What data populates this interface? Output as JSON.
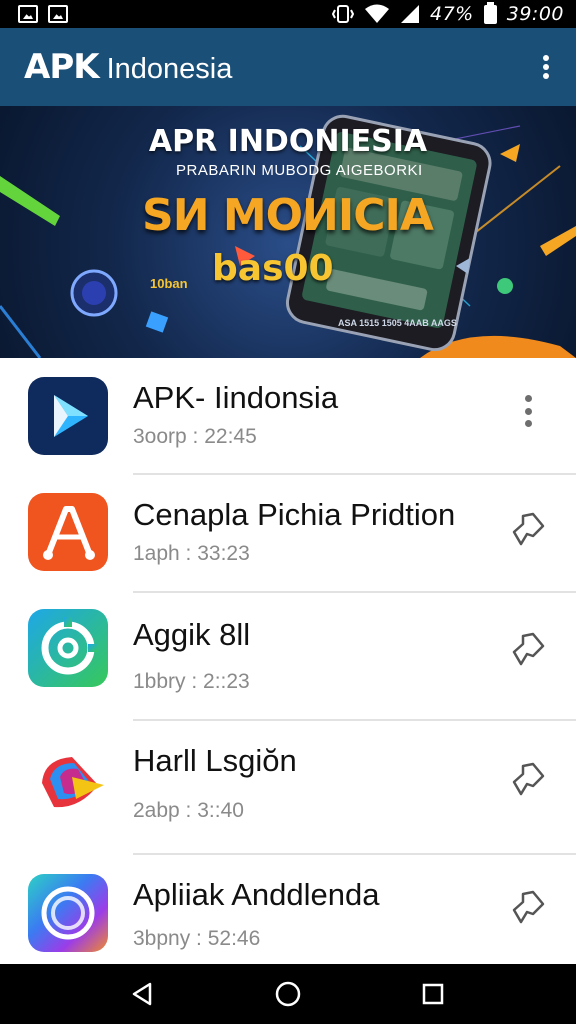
{
  "status_bar": {
    "battery_text": "47%",
    "time": "39:00",
    "icons": [
      "image-icon",
      "image-icon",
      "vibrate-icon",
      "wifi-icon",
      "signal-icon",
      "battery-icon"
    ]
  },
  "app_bar": {
    "brand_strong": "APK",
    "brand_light": "Indonesia",
    "menu_icon": "more-vert-icon"
  },
  "banner": {
    "title": "APR INDONIESIA",
    "subtitle": "PRABARIN MUBODG AIGEBORKI",
    "headline": "SИ MOИICIA",
    "bonus": "bas00",
    "small_left": "10ban",
    "fine_print": "ASA 1515 1505 4AAB AAGS"
  },
  "apps": [
    {
      "title": "APK- Iindonsia",
      "subtitle": "3oorp : 22:45",
      "action_icon": "more-vert-icon",
      "icon": "play-store-icon",
      "colors": [
        "#0f2a5c",
        "#1f8fe6",
        "#7fe0ff"
      ]
    },
    {
      "title": "Cenapla Pichia Pridtion",
      "subtitle": "1aph : 33:23",
      "action_icon": "pin-icon",
      "icon": "orange-a-icon",
      "colors": [
        "#f0541f",
        "#ffffff"
      ]
    },
    {
      "title": "Aggik 8ll",
      "subtitle": "1bbry : 2::23",
      "action_icon": "pin-icon",
      "icon": "target-icon",
      "colors": [
        "#1ea7e8",
        "#37c85a",
        "#ffffff"
      ]
    },
    {
      "title": "Harll Lsgiŏn",
      "subtitle": "2abp : 3::40",
      "action_icon": "pin-icon",
      "icon": "colorful-cone-icon",
      "colors": [
        "#e7333c",
        "#2d8ff0",
        "#f4c414",
        "#c52c8e"
      ]
    },
    {
      "title": "Apliiak Anddlenda",
      "subtitle": "3bpny : 52:46",
      "action_icon": "pin-icon",
      "icon": "ring-icon",
      "colors": [
        "#3b7bf2",
        "#9b3de8",
        "#f08b2b",
        "#2cd1c4"
      ]
    }
  ],
  "nav_bar": {
    "buttons": [
      "back-icon",
      "home-icon",
      "recents-icon"
    ]
  }
}
